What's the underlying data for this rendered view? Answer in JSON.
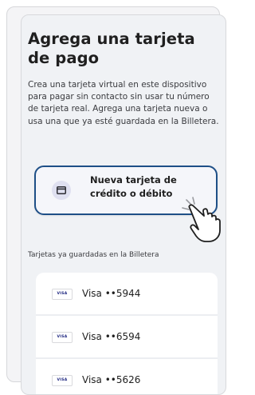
{
  "dialog": {
    "title": "Agrega una tarjeta de pago",
    "description": "Crea una tarjeta virtual en este dispositivo para pagar sin contacto sin usar tu número de tarjeta real. Agrega una tarjeta nueva o usa una que ya esté guardada en la Billetera."
  },
  "new_card_option": {
    "label": "Nueva tarjeta de crédito o débito",
    "icon": "credit-card-icon"
  },
  "saved_cards": {
    "heading": "Tarjetas ya guardadas en la Billetera",
    "items": [
      {
        "brand": "VISA",
        "label": "Visa ••5944"
      },
      {
        "brand": "VISA",
        "label": "Visa ••6594"
      },
      {
        "brand": "VISA",
        "label": "Visa ••5626"
      }
    ]
  },
  "colors": {
    "accent_border": "#1e4f87",
    "sheet_background": "#f0f2f5",
    "icon_circle": "#dfe0f0"
  }
}
